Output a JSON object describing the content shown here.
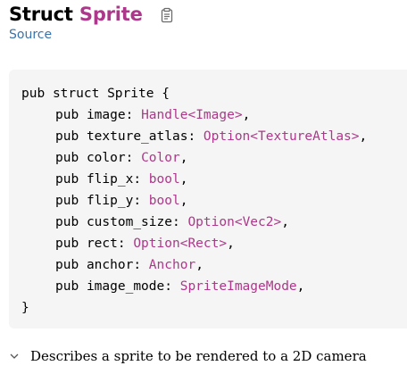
{
  "header": {
    "kind": "Struct",
    "name": "Sprite",
    "source_label": "Source"
  },
  "code": {
    "open_line": {
      "kw_pub": "pub",
      "kw_struct": "struct",
      "name": "Sprite",
      "brace": "{"
    },
    "fields": [
      {
        "kw": "pub",
        "name": "image",
        "type_parts": [
          "Handle",
          "<",
          "Image",
          ">"
        ],
        "trail": ","
      },
      {
        "kw": "pub",
        "name": "texture_atlas",
        "type_parts": [
          "Option",
          "<",
          "TextureAtlas",
          ">"
        ],
        "trail": ","
      },
      {
        "kw": "pub",
        "name": "color",
        "type_parts": [
          "Color"
        ],
        "trail": ","
      },
      {
        "kw": "pub",
        "name": "flip_x",
        "type_parts": [
          "bool"
        ],
        "trail": ","
      },
      {
        "kw": "pub",
        "name": "flip_y",
        "type_parts": [
          "bool"
        ],
        "trail": ","
      },
      {
        "kw": "pub",
        "name": "custom_size",
        "type_parts": [
          "Option",
          "<",
          "Vec2",
          ">"
        ],
        "trail": ","
      },
      {
        "kw": "pub",
        "name": "rect",
        "type_parts": [
          "Option",
          "<",
          "Rect",
          ">"
        ],
        "trail": ","
      },
      {
        "kw": "pub",
        "name": "anchor",
        "type_parts": [
          "Anchor"
        ],
        "trail": ","
      },
      {
        "kw": "pub",
        "name": "image_mode",
        "type_parts": [
          "SpriteImageMode"
        ],
        "trail": ","
      }
    ],
    "close_line": "}"
  },
  "doc": {
    "summary": "Describes a sprite to be rendered to a 2D camera"
  },
  "icons": {
    "copy": "copy-path-icon",
    "toggle": "chevron-down-icon"
  },
  "colors": {
    "type_accent": "#ad378a",
    "link": "#3873ad",
    "code_background": "#f5f5f5"
  }
}
